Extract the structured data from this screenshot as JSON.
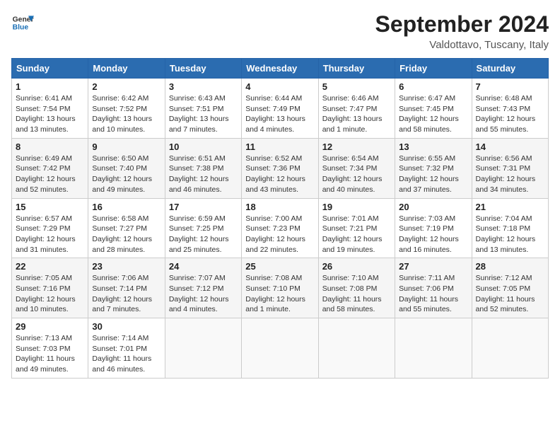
{
  "header": {
    "logo_line1": "General",
    "logo_line2": "Blue",
    "month_year": "September 2024",
    "location": "Valdottavo, Tuscany, Italy"
  },
  "weekdays": [
    "Sunday",
    "Monday",
    "Tuesday",
    "Wednesday",
    "Thursday",
    "Friday",
    "Saturday"
  ],
  "weeks": [
    [
      {
        "day": "1",
        "sunrise": "Sunrise: 6:41 AM",
        "sunset": "Sunset: 7:54 PM",
        "daylight": "Daylight: 13 hours and 13 minutes."
      },
      {
        "day": "2",
        "sunrise": "Sunrise: 6:42 AM",
        "sunset": "Sunset: 7:52 PM",
        "daylight": "Daylight: 13 hours and 10 minutes."
      },
      {
        "day": "3",
        "sunrise": "Sunrise: 6:43 AM",
        "sunset": "Sunset: 7:51 PM",
        "daylight": "Daylight: 13 hours and 7 minutes."
      },
      {
        "day": "4",
        "sunrise": "Sunrise: 6:44 AM",
        "sunset": "Sunset: 7:49 PM",
        "daylight": "Daylight: 13 hours and 4 minutes."
      },
      {
        "day": "5",
        "sunrise": "Sunrise: 6:46 AM",
        "sunset": "Sunset: 7:47 PM",
        "daylight": "Daylight: 13 hours and 1 minute."
      },
      {
        "day": "6",
        "sunrise": "Sunrise: 6:47 AM",
        "sunset": "Sunset: 7:45 PM",
        "daylight": "Daylight: 12 hours and 58 minutes."
      },
      {
        "day": "7",
        "sunrise": "Sunrise: 6:48 AM",
        "sunset": "Sunset: 7:43 PM",
        "daylight": "Daylight: 12 hours and 55 minutes."
      }
    ],
    [
      {
        "day": "8",
        "sunrise": "Sunrise: 6:49 AM",
        "sunset": "Sunset: 7:42 PM",
        "daylight": "Daylight: 12 hours and 52 minutes."
      },
      {
        "day": "9",
        "sunrise": "Sunrise: 6:50 AM",
        "sunset": "Sunset: 7:40 PM",
        "daylight": "Daylight: 12 hours and 49 minutes."
      },
      {
        "day": "10",
        "sunrise": "Sunrise: 6:51 AM",
        "sunset": "Sunset: 7:38 PM",
        "daylight": "Daylight: 12 hours and 46 minutes."
      },
      {
        "day": "11",
        "sunrise": "Sunrise: 6:52 AM",
        "sunset": "Sunset: 7:36 PM",
        "daylight": "Daylight: 12 hours and 43 minutes."
      },
      {
        "day": "12",
        "sunrise": "Sunrise: 6:54 AM",
        "sunset": "Sunset: 7:34 PM",
        "daylight": "Daylight: 12 hours and 40 minutes."
      },
      {
        "day": "13",
        "sunrise": "Sunrise: 6:55 AM",
        "sunset": "Sunset: 7:32 PM",
        "daylight": "Daylight: 12 hours and 37 minutes."
      },
      {
        "day": "14",
        "sunrise": "Sunrise: 6:56 AM",
        "sunset": "Sunset: 7:31 PM",
        "daylight": "Daylight: 12 hours and 34 minutes."
      }
    ],
    [
      {
        "day": "15",
        "sunrise": "Sunrise: 6:57 AM",
        "sunset": "Sunset: 7:29 PM",
        "daylight": "Daylight: 12 hours and 31 minutes."
      },
      {
        "day": "16",
        "sunrise": "Sunrise: 6:58 AM",
        "sunset": "Sunset: 7:27 PM",
        "daylight": "Daylight: 12 hours and 28 minutes."
      },
      {
        "day": "17",
        "sunrise": "Sunrise: 6:59 AM",
        "sunset": "Sunset: 7:25 PM",
        "daylight": "Daylight: 12 hours and 25 minutes."
      },
      {
        "day": "18",
        "sunrise": "Sunrise: 7:00 AM",
        "sunset": "Sunset: 7:23 PM",
        "daylight": "Daylight: 12 hours and 22 minutes."
      },
      {
        "day": "19",
        "sunrise": "Sunrise: 7:01 AM",
        "sunset": "Sunset: 7:21 PM",
        "daylight": "Daylight: 12 hours and 19 minutes."
      },
      {
        "day": "20",
        "sunrise": "Sunrise: 7:03 AM",
        "sunset": "Sunset: 7:19 PM",
        "daylight": "Daylight: 12 hours and 16 minutes."
      },
      {
        "day": "21",
        "sunrise": "Sunrise: 7:04 AM",
        "sunset": "Sunset: 7:18 PM",
        "daylight": "Daylight: 12 hours and 13 minutes."
      }
    ],
    [
      {
        "day": "22",
        "sunrise": "Sunrise: 7:05 AM",
        "sunset": "Sunset: 7:16 PM",
        "daylight": "Daylight: 12 hours and 10 minutes."
      },
      {
        "day": "23",
        "sunrise": "Sunrise: 7:06 AM",
        "sunset": "Sunset: 7:14 PM",
        "daylight": "Daylight: 12 hours and 7 minutes."
      },
      {
        "day": "24",
        "sunrise": "Sunrise: 7:07 AM",
        "sunset": "Sunset: 7:12 PM",
        "daylight": "Daylight: 12 hours and 4 minutes."
      },
      {
        "day": "25",
        "sunrise": "Sunrise: 7:08 AM",
        "sunset": "Sunset: 7:10 PM",
        "daylight": "Daylight: 12 hours and 1 minute."
      },
      {
        "day": "26",
        "sunrise": "Sunrise: 7:10 AM",
        "sunset": "Sunset: 7:08 PM",
        "daylight": "Daylight: 11 hours and 58 minutes."
      },
      {
        "day": "27",
        "sunrise": "Sunrise: 7:11 AM",
        "sunset": "Sunset: 7:06 PM",
        "daylight": "Daylight: 11 hours and 55 minutes."
      },
      {
        "day": "28",
        "sunrise": "Sunrise: 7:12 AM",
        "sunset": "Sunset: 7:05 PM",
        "daylight": "Daylight: 11 hours and 52 minutes."
      }
    ],
    [
      {
        "day": "29",
        "sunrise": "Sunrise: 7:13 AM",
        "sunset": "Sunset: 7:03 PM",
        "daylight": "Daylight: 11 hours and 49 minutes."
      },
      {
        "day": "30",
        "sunrise": "Sunrise: 7:14 AM",
        "sunset": "Sunset: 7:01 PM",
        "daylight": "Daylight: 11 hours and 46 minutes."
      },
      null,
      null,
      null,
      null,
      null
    ]
  ]
}
